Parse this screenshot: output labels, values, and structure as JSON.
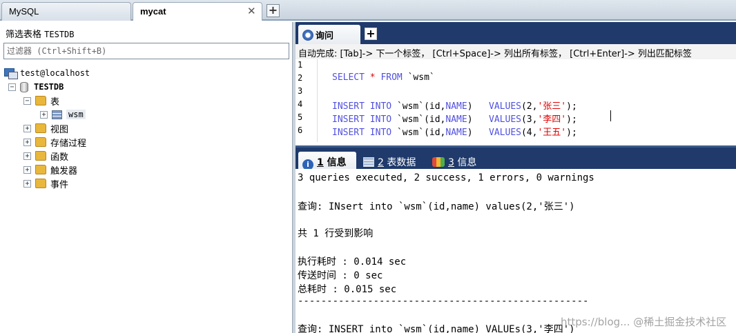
{
  "connection_tabs": [
    {
      "label": "MySQL",
      "active": false
    },
    {
      "label": "mycat",
      "active": true
    }
  ],
  "filter": {
    "label_prefix": "筛选表格",
    "db_name": "TESTDB",
    "placeholder": "过滤器 (Ctrl+Shift+B)"
  },
  "tree": {
    "host": "test@localhost",
    "database": "TESTDB",
    "tables_folder": "表",
    "table": "wsm",
    "folders": [
      "视图",
      "存储过程",
      "函数",
      "触发器",
      "事件"
    ]
  },
  "query_tab": {
    "label": "询问",
    "add": "+"
  },
  "autocomplete": "自动完成:  [Tab]-> 下一个标签， [Ctrl+Space]-> 列出所有标签， [Ctrl+Enter]-> 列出匹配标签",
  "editor": {
    "line_numbers": [
      "1",
      "2",
      "3",
      "4",
      "5",
      "6"
    ],
    "lines": {
      "l2": {
        "kw1": "SELECT",
        "star": "*",
        "kw2": "FROM",
        "tbl": "`wsm`"
      },
      "l4": {
        "kw1": "INSERT",
        "kw2": "INTO",
        "tbl": "`wsm`(id,",
        "col": "NAME",
        "close": ")",
        "kw3": "VALUES",
        "args": "(2,",
        "str": "'张三'",
        "end": ");"
      },
      "l5": {
        "kw1": "INSERT",
        "kw2": "INTO",
        "tbl": "`wsm`(id,",
        "col": "NAME",
        "close": ")",
        "kw3": "VALUES",
        "args": "(3,",
        "str": "'李四'",
        "end": ");"
      },
      "l6": {
        "kw1": "INSERT",
        "kw2": "INTO",
        "tbl": "`wsm`(id,",
        "col": "NAME",
        "close": ")",
        "kw3": "VALUES",
        "args": "(4,",
        "str": "'王五'",
        "end": ");"
      }
    }
  },
  "result_tabs": [
    {
      "num": "1",
      "label": "信息",
      "active": true,
      "icon": "info-icon"
    },
    {
      "num": "2",
      "label": "表数据",
      "active": false,
      "icon": "table-grid-icon"
    },
    {
      "num": "3",
      "label": "信息",
      "active": false,
      "icon": "multi-info-icon"
    }
  ],
  "results": {
    "summary": "3 queries executed, 2 success, 1 errors, 0 warnings",
    "query1": "查询: INsert into `wsm`(id,name) values(2,'张三')",
    "affected": "共 1 行受到影响",
    "exec_time": "执行耗时   : 0.014 sec",
    "transfer_time": "传送时间   : 0 sec",
    "total_time": "总耗时      : 0.015 sec",
    "separator": "--------------------------------------------------",
    "query2": "查询: INSERT into `wsm`(id,name) VALUEs(3,'李四')"
  },
  "watermark": "https://blog... @稀土掘金技术社区",
  "colors": {
    "toolbar_dark": "#1f3a6b",
    "keyword": "#5050e0",
    "string": "#e00000",
    "folder": "#e8b73c"
  }
}
